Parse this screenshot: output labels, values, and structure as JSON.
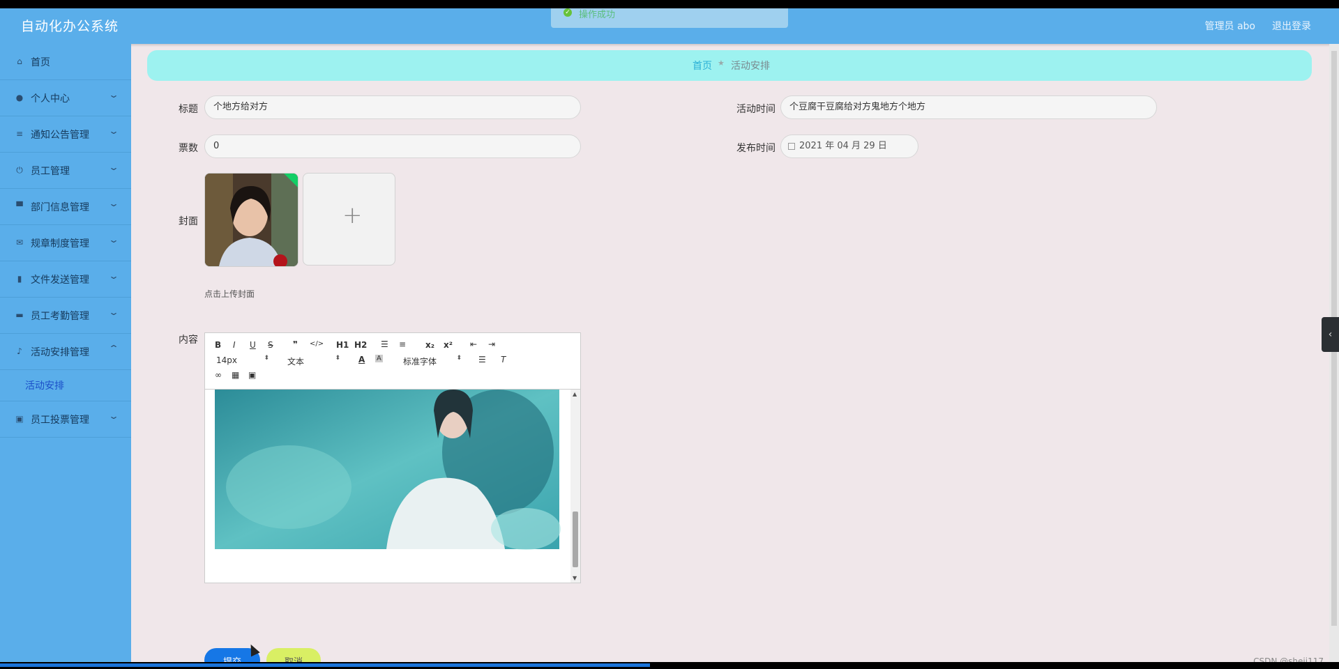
{
  "header": {
    "brand": "自动化办公系统",
    "admin": "管理员 abo",
    "logout": "退出登录"
  },
  "toast": {
    "text": "操作成功"
  },
  "sidebar": {
    "items": [
      {
        "label": "首页",
        "icon": "home-icon"
      },
      {
        "label": "个人中心",
        "icon": "user-icon"
      },
      {
        "label": "通知公告管理",
        "icon": "sliders-icon"
      },
      {
        "label": "员工管理",
        "icon": "power-icon"
      },
      {
        "label": "部门信息管理",
        "icon": "stamp-icon"
      },
      {
        "label": "规章制度管理",
        "icon": "mail-icon"
      },
      {
        "label": "文件发送管理",
        "icon": "bar-chart-icon"
      },
      {
        "label": "员工考勤管理",
        "icon": "ticket-icon"
      },
      {
        "label": "活动安排管理",
        "icon": "mic-icon"
      },
      {
        "label": "员工投票管理",
        "icon": "clipboard-icon"
      }
    ],
    "sub_active": "活动安排"
  },
  "breadcrumb": {
    "home": "首页",
    "current": "活动安排"
  },
  "form": {
    "title_label": "标题",
    "title_value": "个地方给对方",
    "votes_label": "票数",
    "votes_value": "0",
    "activity_time_label": "活动时间",
    "activity_time_value": "个豆腐干豆腐给对方鬼地方个地方",
    "publish_time_label": "发布时间",
    "publish_time_value": "2021 年 04 月 29 日",
    "cover_label": "封面",
    "cover_hint": "点击上传封面",
    "content_label": "内容"
  },
  "editor": {
    "font_size": "14px",
    "header_select": "文本",
    "font_family": "标准字体",
    "buttons": [
      "B",
      "I",
      "U",
      "S",
      "❞",
      "</>",
      "H1",
      "H2",
      "ol",
      "ul",
      "x₂",
      "x²",
      "outdent",
      "indent"
    ]
  },
  "actions": {
    "submit": "提交",
    "cancel": "取消"
  },
  "watermark": "CSDN @sheji117",
  "colors": {
    "header": "#5aaeea",
    "breadcrumb": "#9df2f0",
    "submit": "#1677e6",
    "cancel": "#d9ef64"
  }
}
